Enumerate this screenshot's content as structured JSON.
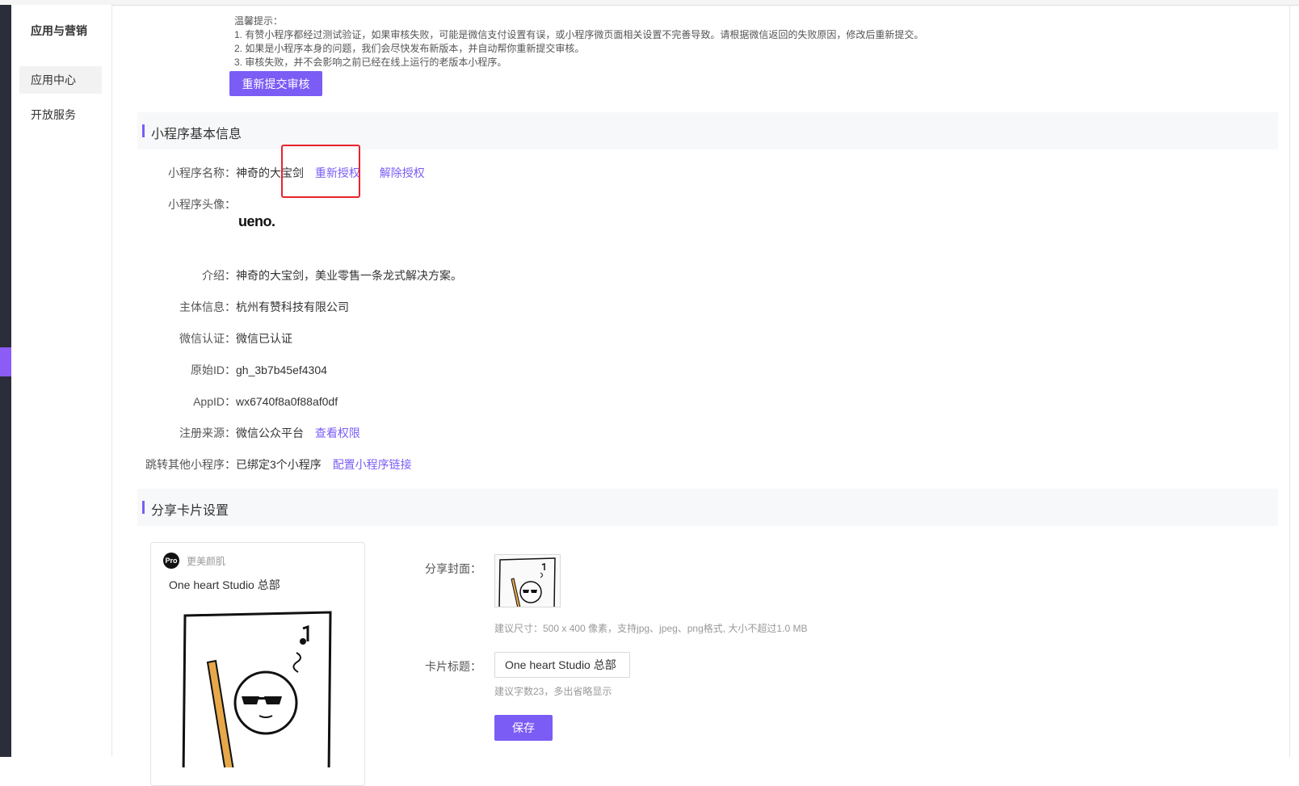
{
  "sidebar": {
    "title": "应用与营销",
    "items": [
      {
        "label": "应用中心"
      },
      {
        "label": "开放服务"
      }
    ]
  },
  "tips": {
    "heading": "温馨提示：",
    "lines": [
      "1. 有赞小程序都经过测试验证，如果审核失败，可能是微信支付设置有误，或小程序微页面相关设置不完善导致。请根据微信返回的失败原因，修改后重新提交。",
      "2. 如果是小程序本身的问题，我们会尽快发布新版本，并自动帮你重新提交审核。",
      "3. 审核失败，并不会影响之前已经在线上运行的老版本小程序。"
    ],
    "resubmit_button": "重新提交审核"
  },
  "basic_info": {
    "section_title": "小程序基本信息",
    "name_label": "小程序名称：",
    "name_value": "神奇的大宝剑",
    "reauthorize_link": "重新授权",
    "deauthorize_link": "解除授权",
    "avatar_label": "小程序头像：",
    "avatar_logo": "ueno.",
    "intro_label": "介绍：",
    "intro_value": "神奇的大宝剑，美业零售一条龙式解决方案。",
    "entity_label": "主体信息：",
    "entity_value": "杭州有赞科技有限公司",
    "wechat_cert_label": "微信认证：",
    "wechat_cert_value": "微信已认证",
    "original_id_label": "原始ID：",
    "original_id_value": "gh_3b7b45ef4304",
    "appid_label": "AppID：",
    "appid_value": "wx6740f8a0f88af0df",
    "source_label": "注册来源：",
    "source_value": "微信公众平台",
    "view_permissions_link": "查看权限",
    "jump_label": "跳转其他小程序：",
    "jump_value": "已绑定3个小程序",
    "config_link": "配置小程序链接"
  },
  "share_card": {
    "section_title": "分享卡片设置",
    "preview": {
      "badge": "Pro",
      "brand": "更美颜肌",
      "title": "One heart Studio 总部"
    },
    "cover_label": "分享封面：",
    "cover_hint": "建议尺寸：500 x 400 像素，支持jpg、jpeg、png格式, 大小不超过1.0 MB",
    "title_label": "卡片标题：",
    "title_value": "One heart Studio 总部",
    "title_hint": "建议字数23，多出省略显示",
    "save_button": "保存"
  },
  "colors": {
    "accent": "#7b5cf5",
    "highlight_box": "#e8232d",
    "rail": "#2b2d3a"
  }
}
